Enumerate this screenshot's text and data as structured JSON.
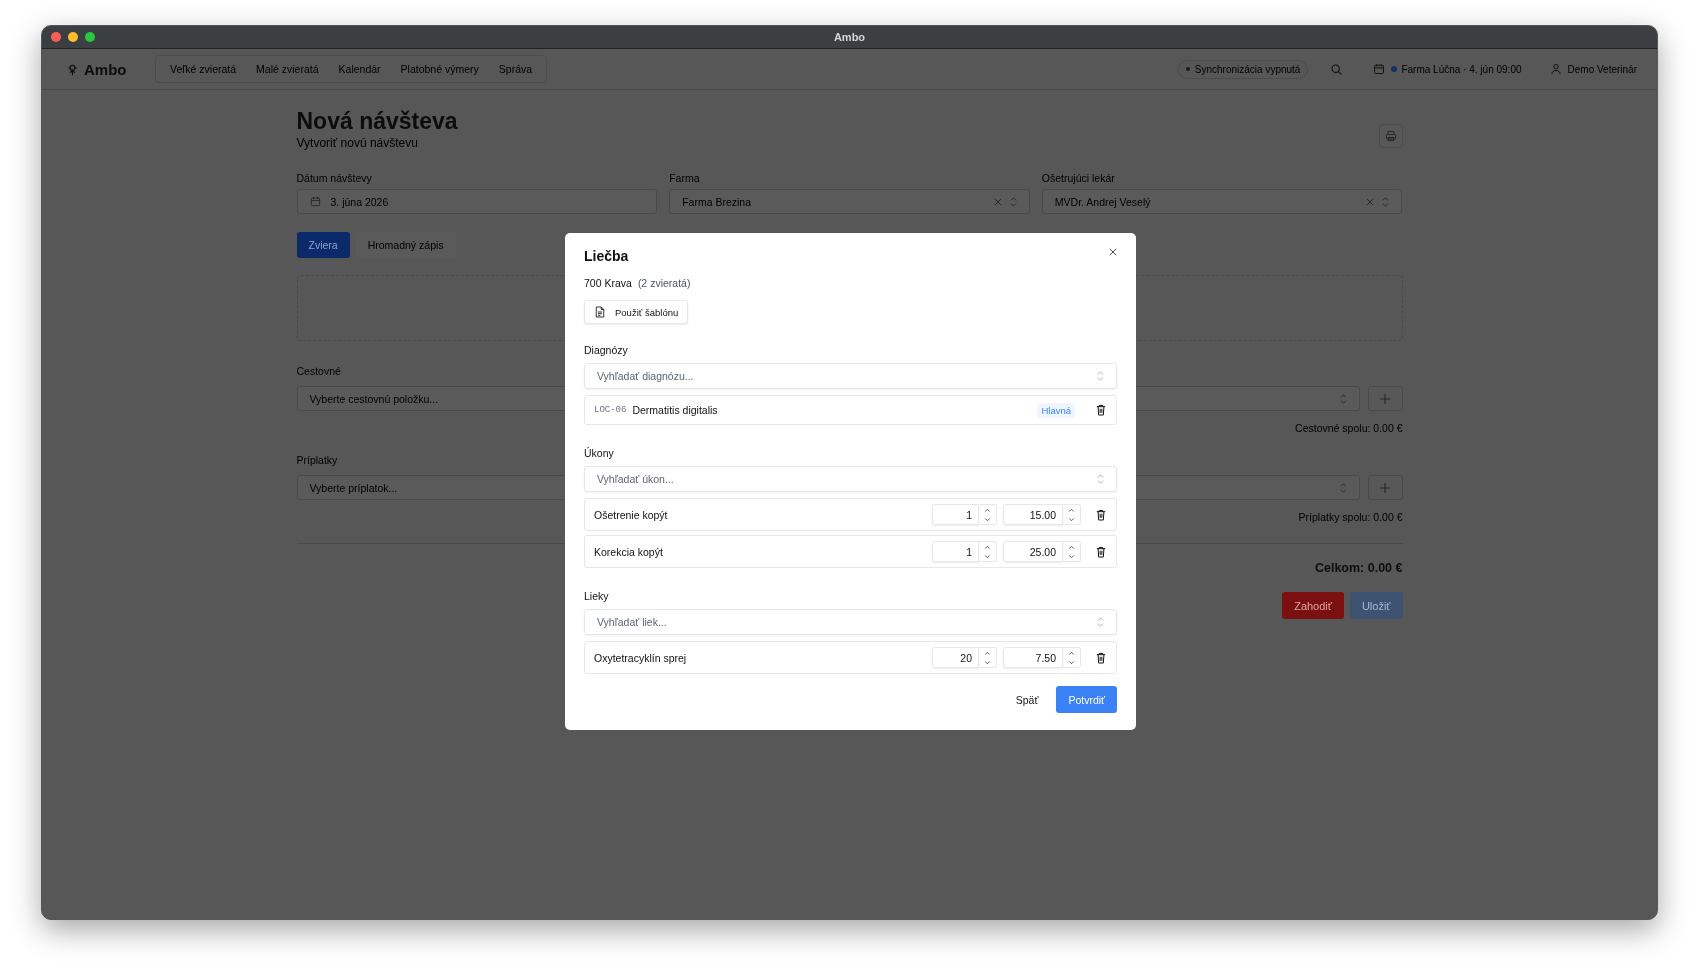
{
  "window": {
    "title": "Ambo"
  },
  "app": {
    "name": "Ambo"
  },
  "nav": [
    {
      "label": "Veľké zvieratá"
    },
    {
      "label": "Malé zvieratá"
    },
    {
      "label": "Kalendár"
    },
    {
      "label": "Platobné výmery"
    },
    {
      "label": "Správa"
    }
  ],
  "header": {
    "sync": "Synchronizácia vypnutá",
    "context": "Farma Lúčna · 4. jún 09:00",
    "user": "Demo Veterinár"
  },
  "page": {
    "title": "Nová návšteva",
    "subtitle": "Vytvoriť novú návštevu",
    "fields": [
      {
        "kind": "date",
        "label": "Dátum návštevy",
        "value": "3. júna 2026"
      },
      {
        "kind": "select",
        "label": "Farma",
        "value": "Farma Brezina"
      },
      {
        "kind": "select",
        "label": "Ošetrujúci lekár",
        "value": "MVDr. Andrej Veselý"
      }
    ],
    "tabs": [
      {
        "label": "Zviera",
        "selected": true
      },
      {
        "label": "Hromadný zápis",
        "selected": false
      }
    ],
    "sections": [
      {
        "label": "Cestovné",
        "placeholder": "Vyberte cestovnú položku...",
        "total": "Cestovné spolu: 0.00 €"
      },
      {
        "label": "Príplatky",
        "placeholder": "Vyberte príplatok...",
        "total": "Príplatky spolu: 0.00 €"
      }
    ],
    "grand_total": "Celkom: 0.00 €",
    "buttons": [
      {
        "kind": "danger",
        "label": "Zahodiť"
      },
      {
        "kind": "primary",
        "label": "Uložiť"
      }
    ]
  },
  "dialog": {
    "title": "Liečba",
    "subject": "700 Krava",
    "count": "(2 zvieratá)",
    "template_button": "Použiť šablónu",
    "sections": [
      {
        "label": "Diagnózy",
        "placeholder": "Vyhľadať diagnózu...",
        "items": [
          {
            "kind": "diagnosis",
            "code": "LOC-06",
            "name": "Dermatitis digitalis",
            "badge": "Hlavná"
          }
        ]
      },
      {
        "label": "Úkony",
        "placeholder": "Vyhľadať úkon...",
        "items": [
          {
            "kind": "line",
            "name": "Ošetrenie kopýt",
            "quantity": "1",
            "price": "15.00"
          },
          {
            "kind": "line",
            "name": "Korekcia kopýt",
            "quantity": "1",
            "price": "25.00"
          }
        ]
      },
      {
        "label": "Lieky",
        "placeholder": "Vyhľadať liek...",
        "items": [
          {
            "kind": "line",
            "name": "Oxytetracyklín sprej",
            "quantity": "20",
            "price": "7.50"
          }
        ]
      }
    ],
    "back_button": "Späť",
    "confirm_button": "Potvrdiť"
  }
}
